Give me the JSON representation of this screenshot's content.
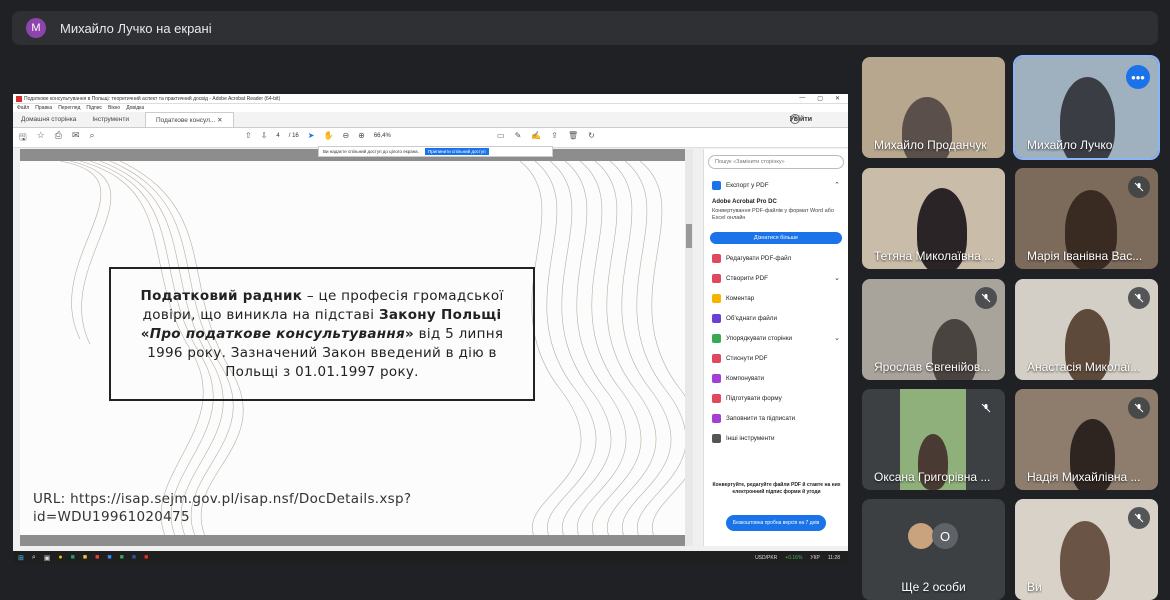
{
  "banner": {
    "avatar_letter": "M",
    "text": "Михайло Лучко на екрані"
  },
  "acrobat": {
    "window_title": "Податкове консультування в Польщі: теоретичний аспект та практичний досвід - Adobe Acrobat Reader (64-bit)",
    "menu": [
      "Файл",
      "Правка",
      "Перегляд",
      "Підпис",
      "Вікно",
      "Довідка"
    ],
    "tabs": [
      "Домашня сторінка",
      "Інструменти",
      "Податкове консул..."
    ],
    "signin": "Увійти",
    "page_current": "4",
    "page_total": "/ 16",
    "zoom": "66,4%",
    "share_notice": "Ви надаєте спільний доступ до цілого екрана.",
    "share_stop": "Припинити спільний доступ",
    "panel": {
      "search_placeholder": "Пошук «Замінити сторінку»",
      "export": "Експорт у PDF",
      "promo_title": "Adobe Acrobat Pro DC",
      "promo_text": "Конвертування PDF-файлів у формат Word або Excel онлайн",
      "promo_button": "Дізнатися більше",
      "tools": [
        {
          "label": "Редагувати PDF-файл",
          "color": "#e0485d"
        },
        {
          "label": "Створити PDF",
          "color": "#e0485d"
        },
        {
          "label": "Коментар",
          "color": "#f5b400"
        },
        {
          "label": "Об'єднати файли",
          "color": "#6a3fd6"
        },
        {
          "label": "Упорядкувати сторінки",
          "color": "#38a852"
        },
        {
          "label": "Стиснути PDF",
          "color": "#e0485d"
        },
        {
          "label": "Компонувати",
          "color": "#a33fd6"
        },
        {
          "label": "Підготувати форму",
          "color": "#e0485d"
        },
        {
          "label": "Заповнити та підписати",
          "color": "#a33fd6"
        },
        {
          "label": "Інші інструменти",
          "color": "#555555"
        }
      ],
      "bottom_text": "Конвертуйте, редагуйте файли PDF й ставте на них електронний підпис форми й угоди",
      "trial_button": "Безкоштовна пробна версія на 7 днів"
    },
    "document": {
      "quote_bold1": "Податковий радник",
      "quote_t1": " – це професія громадської довіри, що виникла на підставі ",
      "quote_bold2": "Закону Польщі «",
      "quote_italic": "Про податкове консультування",
      "quote_bold3": "»",
      "quote_t2": " від 5 липня 1996 року. Зазначений Закон введений в дію в Польщі з 01.01.1997 року.",
      "url_line1": "URL: https://isap.sejm.gov.pl/isap.nsf/DocDetails.xsp?",
      "url_line2": "id=WDU19961020475"
    },
    "taskbar": {
      "ticker": "USD/PKR",
      "change": "+0.16%",
      "lang": "УКР",
      "time": "11:28"
    }
  },
  "participants": [
    {
      "name": "Михайло Проданчук"
    },
    {
      "name": "Михайло Лучко"
    },
    {
      "name": "Тетяна Миколаївна ..."
    },
    {
      "name": "Марія Іванівна Вас..."
    },
    {
      "name": "Ярослав Євгенійов..."
    },
    {
      "name": "Анастасія Миколаї..."
    },
    {
      "name": "Оксана Григорівна ..."
    },
    {
      "name": "Надія Михайлівна ..."
    },
    {
      "name": "Ще 2 особи",
      "avatar_letter": "O"
    },
    {
      "name": "Ви"
    }
  ]
}
